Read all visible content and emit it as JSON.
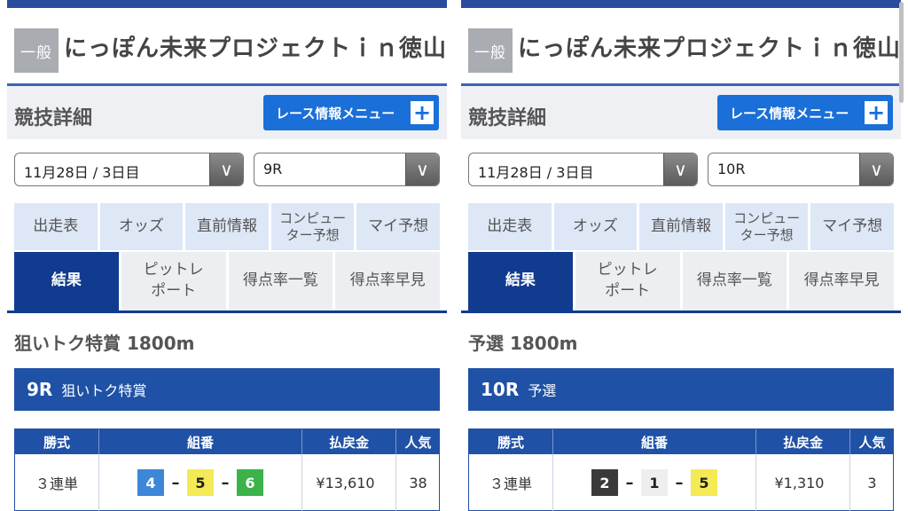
{
  "panels": [
    {
      "venue_badge": "一般",
      "venue_title": "にっぽん未来プロジェクトｉｎ徳山",
      "detail_title": "競技詳細",
      "race_menu_label": "レース情報メニュー",
      "plus": "+",
      "day_select": "11月28日 / 3日目",
      "race_select": "9R",
      "arrow": "∨",
      "tabs_row1": [
        "出走表",
        "オッズ",
        "直前情報",
        "コンピュー\nター予想",
        "マイ予想"
      ],
      "tabs_row2": [
        "結果",
        "ピットレ\nポート",
        "得点率一覧",
        "得点率早見"
      ],
      "race_heading": "狙いトク特賞 1800m",
      "race_no": "9R",
      "race_name": "狙いトク特賞",
      "table_headers": [
        "勝式",
        "組番",
        "払戻金",
        "人気"
      ],
      "bet_type": "３連単",
      "combo": [
        {
          "num": "4",
          "bg": "#3d86d8",
          "fg": "#ffffff"
        },
        {
          "num": "5",
          "bg": "#f4ea55",
          "fg": "#222222"
        },
        {
          "num": "6",
          "bg": "#3bb34a",
          "fg": "#ffffff"
        }
      ],
      "dash": "–",
      "payout": "¥13,610",
      "popularity": "38"
    },
    {
      "venue_badge": "一般",
      "venue_title": "にっぽん未来プロジェクトｉｎ徳山",
      "detail_title": "競技詳細",
      "race_menu_label": "レース情報メニュー",
      "plus": "+",
      "day_select": "11月28日 / 3日目",
      "race_select": "10R",
      "arrow": "∨",
      "tabs_row1": [
        "出走表",
        "オッズ",
        "直前情報",
        "コンピュー\nター予想",
        "マイ予想"
      ],
      "tabs_row2": [
        "結果",
        "ピットレ\nポート",
        "得点率一覧",
        "得点率早見"
      ],
      "race_heading": "予選 1800m",
      "race_no": "10R",
      "race_name": "予選",
      "table_headers": [
        "勝式",
        "組番",
        "払戻金",
        "人気"
      ],
      "bet_type": "３連単",
      "combo": [
        {
          "num": "2",
          "bg": "#3a3a3a",
          "fg": "#ffffff"
        },
        {
          "num": "1",
          "bg": "#eeeeee",
          "fg": "#222222"
        },
        {
          "num": "5",
          "bg": "#f4ea55",
          "fg": "#222222"
        }
      ],
      "dash": "–",
      "payout": "¥1,310",
      "popularity": "3"
    }
  ],
  "colors": {
    "accent": "#1a6fd8",
    "navy": "#103b8e",
    "banner": "#1f51a6",
    "tab_light": "#dde7f6"
  }
}
